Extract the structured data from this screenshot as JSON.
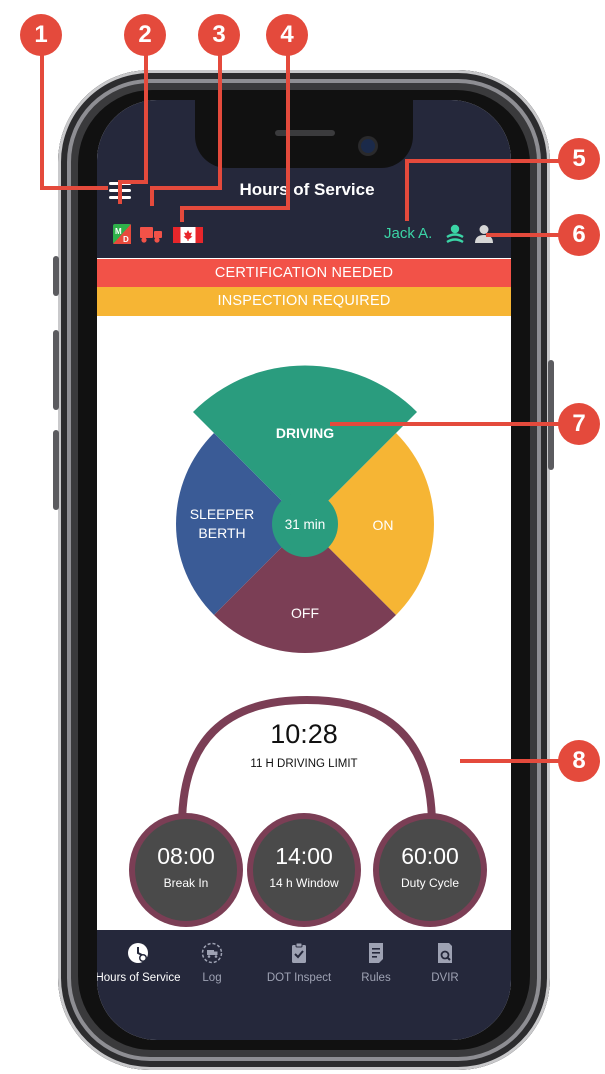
{
  "app": {
    "title": "Hours of Service",
    "driver_name": "Jack A."
  },
  "banners": {
    "certification": "CERTIFICATION NEEDED",
    "inspection": "INSPECTION REQUIRED"
  },
  "duty_wheel": {
    "driving_label": "DRIVING",
    "on_label": "ON",
    "off_label": "OFF",
    "sleeper_line1": "SLEEPER",
    "sleeper_line2": "BERTH",
    "center_time": "31 min",
    "colors": {
      "driving": "#2a9c7e",
      "on": "#f6b534",
      "off": "#7b3e55",
      "sleeper": "#3a5b96"
    }
  },
  "timers": {
    "main_time": "10:28",
    "main_label": "11 H DRIVING LIMIT",
    "break_time": "08:00",
    "break_label": "Break In",
    "window_time": "14:00",
    "window_label": "14 h Window",
    "cycle_time": "60:00",
    "cycle_label": "Duty Cycle"
  },
  "nav": {
    "items": [
      {
        "label": "Hours of Service",
        "icon": "hos-clock-icon"
      },
      {
        "label": "Log",
        "icon": "log-truck-icon"
      },
      {
        "label": "DOT Inspect",
        "icon": "clipboard-check-icon"
      },
      {
        "label": "Rules",
        "icon": "rules-document-icon"
      },
      {
        "label": "DVIR",
        "icon": "dvir-search-icon"
      }
    ]
  },
  "callouts": [
    "1",
    "2",
    "3",
    "4",
    "5",
    "6",
    "7",
    "8"
  ],
  "colors": {
    "accent": "#e44a3c",
    "topbar": "#25283b",
    "user_green": "#3bd4a6",
    "red_banner": "#f25248",
    "yellow_banner": "#f6b534"
  }
}
